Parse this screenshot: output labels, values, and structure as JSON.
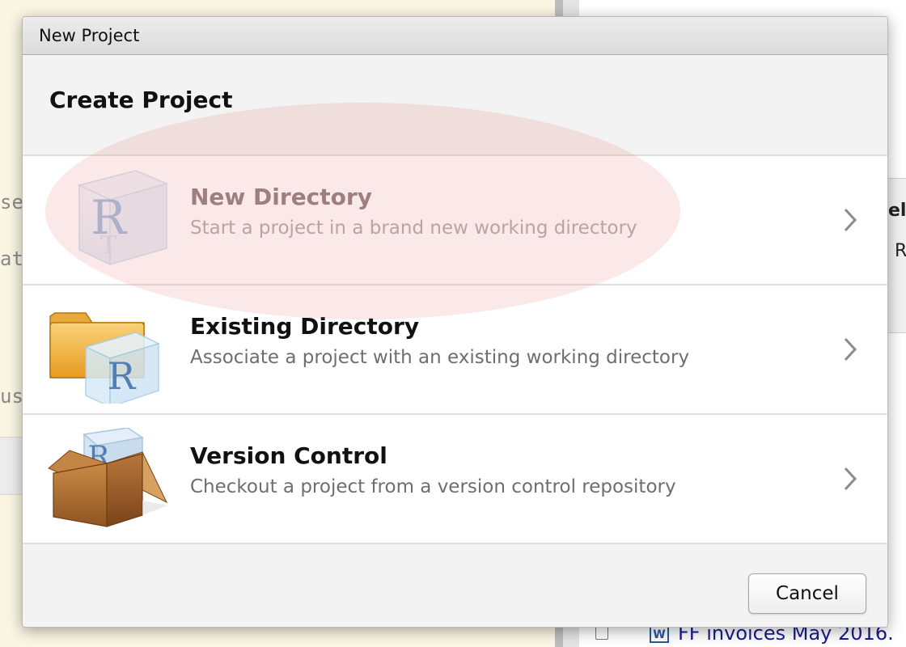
{
  "background": {
    "left_fragments": [
      "se",
      "at",
      "us"
    ],
    "right_fragments": [
      "el",
      "R"
    ],
    "file_name": "FF invoices May 2016.",
    "file_icon": "word-document-icon"
  },
  "dialog": {
    "title": "New Project",
    "heading": "Create Project",
    "options": [
      {
        "title": "New Directory",
        "description": "Start a project in a brand new working directory",
        "icon": "r-cube-icon",
        "highlighted": true
      },
      {
        "title": "Existing Directory",
        "description": "Associate a project with an existing working directory",
        "icon": "folder-r-cube-icon"
      },
      {
        "title": "Version Control",
        "description": "Checkout a project from a version control repository",
        "icon": "box-r-cube-icon"
      }
    ],
    "cancel_label": "Cancel"
  },
  "colors": {
    "dialog_bg": "#f2f3f2",
    "highlight": "#ec8c8c",
    "title_text": "#111111",
    "desc_text": "#6e6e6e"
  }
}
